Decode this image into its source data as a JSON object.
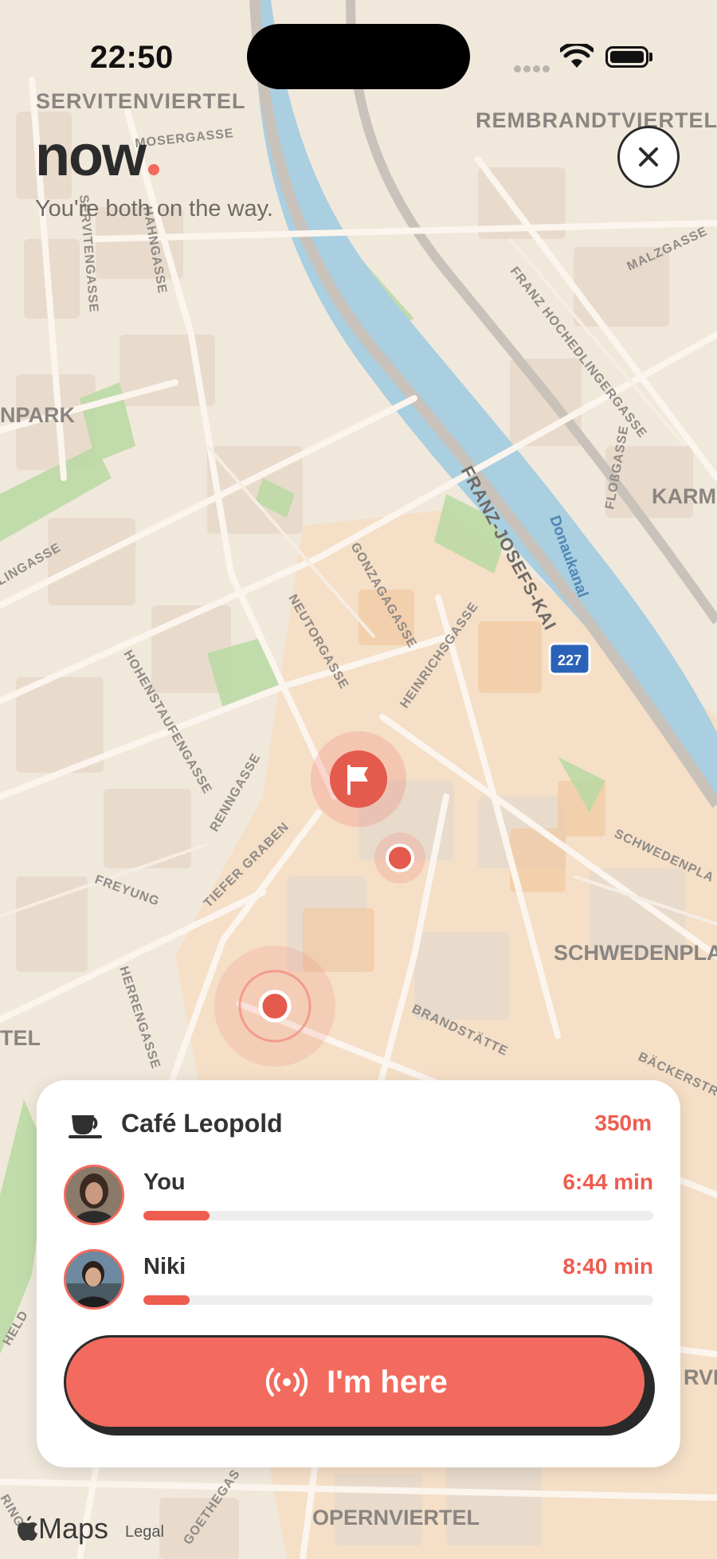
{
  "status_bar": {
    "time": "22:50"
  },
  "header": {
    "logo_text": "now",
    "subtitle": "You're both on the way."
  },
  "map": {
    "labels": {
      "servitenviertel": "SERVITENVIERTEL",
      "rembrandtviertel": "REMBRANDTVIERTEL",
      "park": "NPARK",
      "karm": "KARM",
      "donaukanal": "Donaukanal",
      "franz_josefs_kai": "FRANZ-JOSEFS-KAI",
      "road_shield": "227",
      "schwedenplatz": "SCHWEDENPLAT",
      "opernviertel": "OPERNVIERTEL",
      "tel": "TEL",
      "mosergasse": "MOSERGASSE",
      "servitengasse": "SERVITENGASSE",
      "hahngasse": "HAHNGASSE",
      "malzgasse": "MALZGASSE",
      "franz_hochedlinger": "FRANZ HOCHEDLINGERGASSE",
      "flossgasse": "FLOßGASSE",
      "gonzagagasse": "GONZAGAGASSE",
      "neutorgasse": "NEUTORGASSE",
      "heinrichsgasse": "HEINRICHSGASSE",
      "hohenstaufengasse": "HOHENSTAUFENGASSE",
      "renngasse": "RENNGASSE",
      "tiefer_graben": "TIEFER GRABEN",
      "freyung": "FREYUNG",
      "herrengasse": "HERRENGASSE",
      "brandstaette": "BRANDSTÄTTE",
      "schwedenplatz_small": "SCHWEDENPLA",
      "baeckerstr": "BÄCKERSTR",
      "lingasse": "LINGASSE",
      "goethegasse": "GOETHEGAS",
      "held": "HELD",
      "ring": "RING",
      "rvi": "RVI"
    }
  },
  "card": {
    "venue_icon": "coffee-cup-icon",
    "venue_name": "Café Leopold",
    "distance": "350m",
    "people": [
      {
        "name": "You",
        "eta": "6:44 min",
        "progress": 0.13
      },
      {
        "name": "Niki",
        "eta": "8:40 min",
        "progress": 0.09
      }
    ],
    "action_label": "I'm here",
    "action_icon": "broadcast-icon"
  },
  "footer": {
    "maps_brand": "Maps",
    "legal": "Legal"
  },
  "colors": {
    "accent": "#f26b5e",
    "dark": "#2a2a2a",
    "map_water": "#a9cfe0",
    "map_park": "#b9d9a2"
  }
}
